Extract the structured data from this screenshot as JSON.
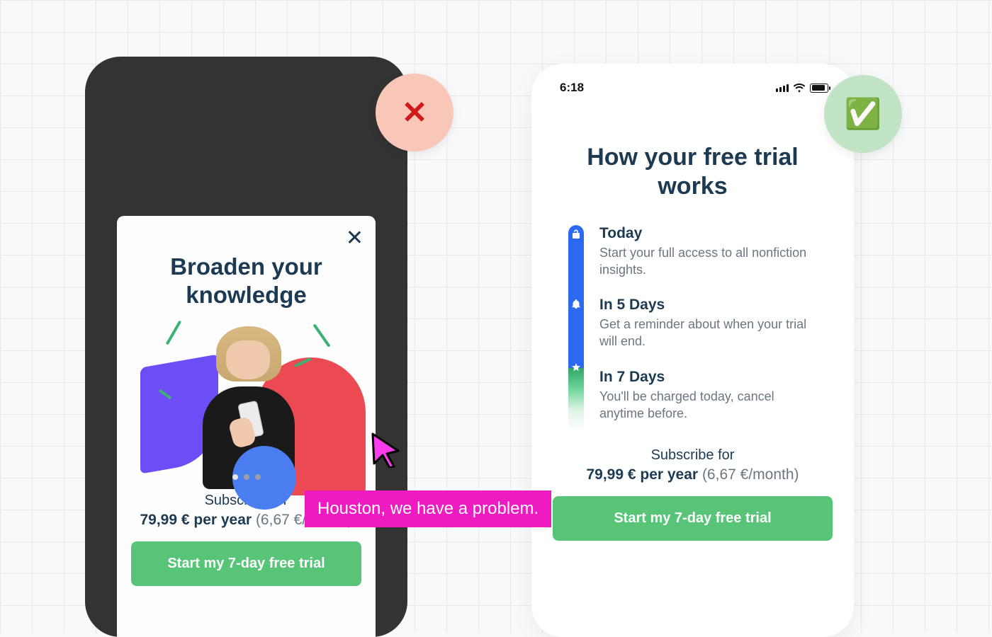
{
  "badges": {
    "bad_glyph": "✕",
    "good_glyph": "✅"
  },
  "annotation": "Houston, we have a problem.",
  "left": {
    "heading_l1": "Broaden your",
    "heading_l2": "knowledge",
    "subscribe_for": "Subscribe for",
    "price": "79,99 € per year",
    "per_month": "(6,67 €/month)",
    "cta": "Start my 7-day free trial"
  },
  "right": {
    "status_time": "6:18",
    "heading_l1": "How your free trial",
    "heading_l2": "works",
    "steps": [
      {
        "title": "Today",
        "desc": "Start your full access to all nonfiction insights."
      },
      {
        "title": "In 5 Days",
        "desc": "Get a reminder about when your trial will end."
      },
      {
        "title": "In 7 Days",
        "desc": "You'll be charged today, cancel anytime before."
      }
    ],
    "subscribe_for": "Subscribe for",
    "price": "79,99 € per year",
    "per_month": "(6,67 €/month)",
    "cta": "Start my 7-day free trial"
  }
}
